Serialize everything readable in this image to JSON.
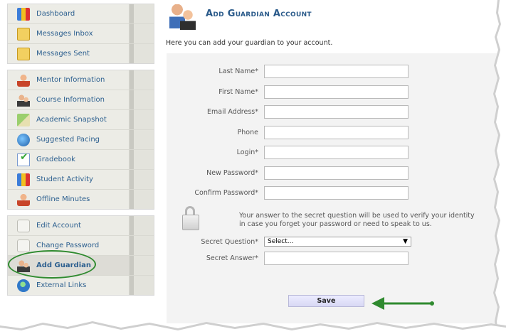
{
  "sidebar": {
    "groups": [
      {
        "items": [
          {
            "label": "Dashboard",
            "icon": "books-icon"
          },
          {
            "label": "Messages Inbox",
            "icon": "envelope-icon"
          },
          {
            "label": "Messages Sent",
            "icon": "envelope-icon"
          }
        ]
      },
      {
        "items": [
          {
            "label": "Mentor Information",
            "icon": "person-icon"
          },
          {
            "label": "Course Information",
            "icon": "people-icon"
          },
          {
            "label": "Academic Snapshot",
            "icon": "chart-icon"
          },
          {
            "label": "Suggested Pacing",
            "icon": "clock-globe-icon"
          },
          {
            "label": "Gradebook",
            "icon": "gradebook-check-icon"
          },
          {
            "label": "Student Activity",
            "icon": "books-icon"
          },
          {
            "label": "Offline Minutes",
            "icon": "person-icon"
          }
        ]
      },
      {
        "items": [
          {
            "label": "Edit Account",
            "icon": "lock-icon"
          },
          {
            "label": "Change Password",
            "icon": "lock-icon"
          },
          {
            "label": "Add Guardian",
            "icon": "people-icon",
            "active": true
          },
          {
            "label": "External Links",
            "icon": "globe-icon"
          }
        ]
      }
    ]
  },
  "page": {
    "title": "Add Guardian Account",
    "intro": "Here you can add your guardian to your account."
  },
  "form": {
    "last_name_label": "Last Name*",
    "first_name_label": "First Name*",
    "email_label": "Email Address*",
    "phone_label": "Phone",
    "login_label": "Login*",
    "new_password_label": "New Password*",
    "confirm_password_label": "Confirm Password*",
    "secret_note": "Your answer to the secret question will be used to verify your identity in case you forget your password or need to speak to us.",
    "secret_question_label": "Secret Question*",
    "secret_question_value": "Select...",
    "secret_question_arrow": "▼",
    "secret_answer_label": "Secret Answer*",
    "save_label": "Save"
  },
  "colors": {
    "annotation": "#2f8a2f",
    "link": "#2c5f8f"
  }
}
